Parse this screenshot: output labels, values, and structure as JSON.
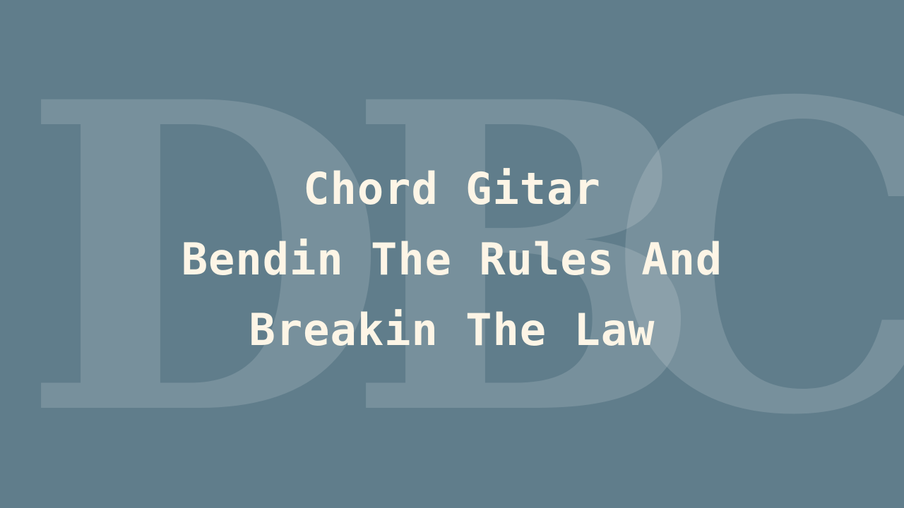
{
  "watermark": {
    "letters": [
      "D",
      "B",
      "C"
    ],
    "color": "#ffffff"
  },
  "title": {
    "lines": [
      "Chord Gitar",
      "Bendin The Rules And",
      "Breakin The Law"
    ],
    "color": "#fdf5e6"
  },
  "background_color": "#607d8b"
}
